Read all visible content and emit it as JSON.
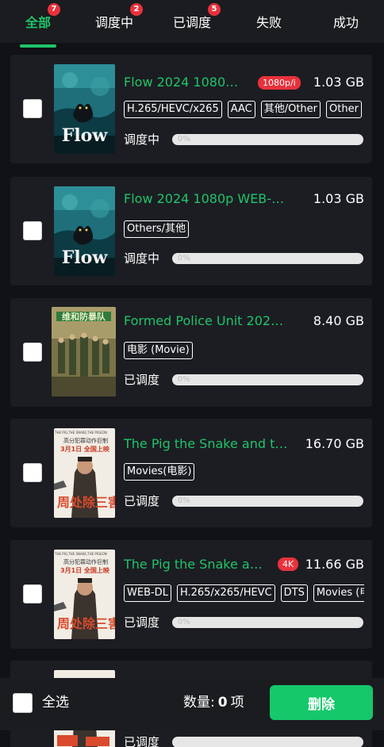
{
  "tabs": [
    {
      "label": "全部",
      "badge": "7",
      "active": true
    },
    {
      "label": "调度中",
      "badge": "2"
    },
    {
      "label": "已调度",
      "badge": "5"
    },
    {
      "label": "失败"
    },
    {
      "label": "成功"
    }
  ],
  "items": [
    {
      "title": "Flow 2024 1080p...",
      "resolution": "1080p/i",
      "size": "1.03 GB",
      "tags": [
        "H.265/HEVC/x265",
        "AAC",
        "其他/Other",
        "Other"
      ],
      "status": "调度中",
      "progress_text": "0%",
      "progress": 0,
      "poster": "Flow"
    },
    {
      "title": "Flow 2024 1080p WEB-DL...",
      "size": "1.03 GB",
      "tags": [
        "Others/其他"
      ],
      "status": "调度中",
      "progress_text": "0%",
      "progress": 0,
      "poster": "Flow"
    },
    {
      "title": "Formed Police Unit 2024...",
      "size": "8.40 GB",
      "tags": [
        "电影 (Movie)"
      ],
      "status": "已调度",
      "progress_text": "0%",
      "progress": 0,
      "poster": "维和防暴队"
    },
    {
      "title": "The Pig the Snake and the...",
      "size": "16.70 GB",
      "tags": [
        "Movies(电影)"
      ],
      "status": "已调度",
      "progress_text": "0%",
      "progress": 0,
      "poster_lines": [
        "THE PIG,THE SNAKE,THE PIGEON",
        "高分犯罪动作巨制",
        "3月1日 全国上映",
        "周处除三害"
      ]
    },
    {
      "title": "The Pig the Snake and...",
      "resolution": "4K",
      "size": "11.66 GB",
      "tags": [
        "WEB-DL",
        "H.265/x265/HEVC",
        "DTS",
        "Movies (电影)"
      ],
      "status": "已调度",
      "progress_text": "0%",
      "progress": 0,
      "poster_lines": [
        "THE PIG,THE SNAKE,THE PIGEON",
        "高分犯罪动作巨制",
        "3月1日 全国上映",
        "周处除三害"
      ]
    },
    {
      "title": "",
      "size": "",
      "tags": [],
      "status": "已调度",
      "progress_text": "",
      "progress": 0
    }
  ],
  "bottom": {
    "select_all": "全选",
    "count_label": "数量:",
    "count_value": "0",
    "count_unit": "项",
    "delete_label": "删除"
  },
  "colors": {
    "accent": "#1fc46a",
    "badge": "#e8323c",
    "background": "#111215",
    "card": "#1c1d22"
  }
}
